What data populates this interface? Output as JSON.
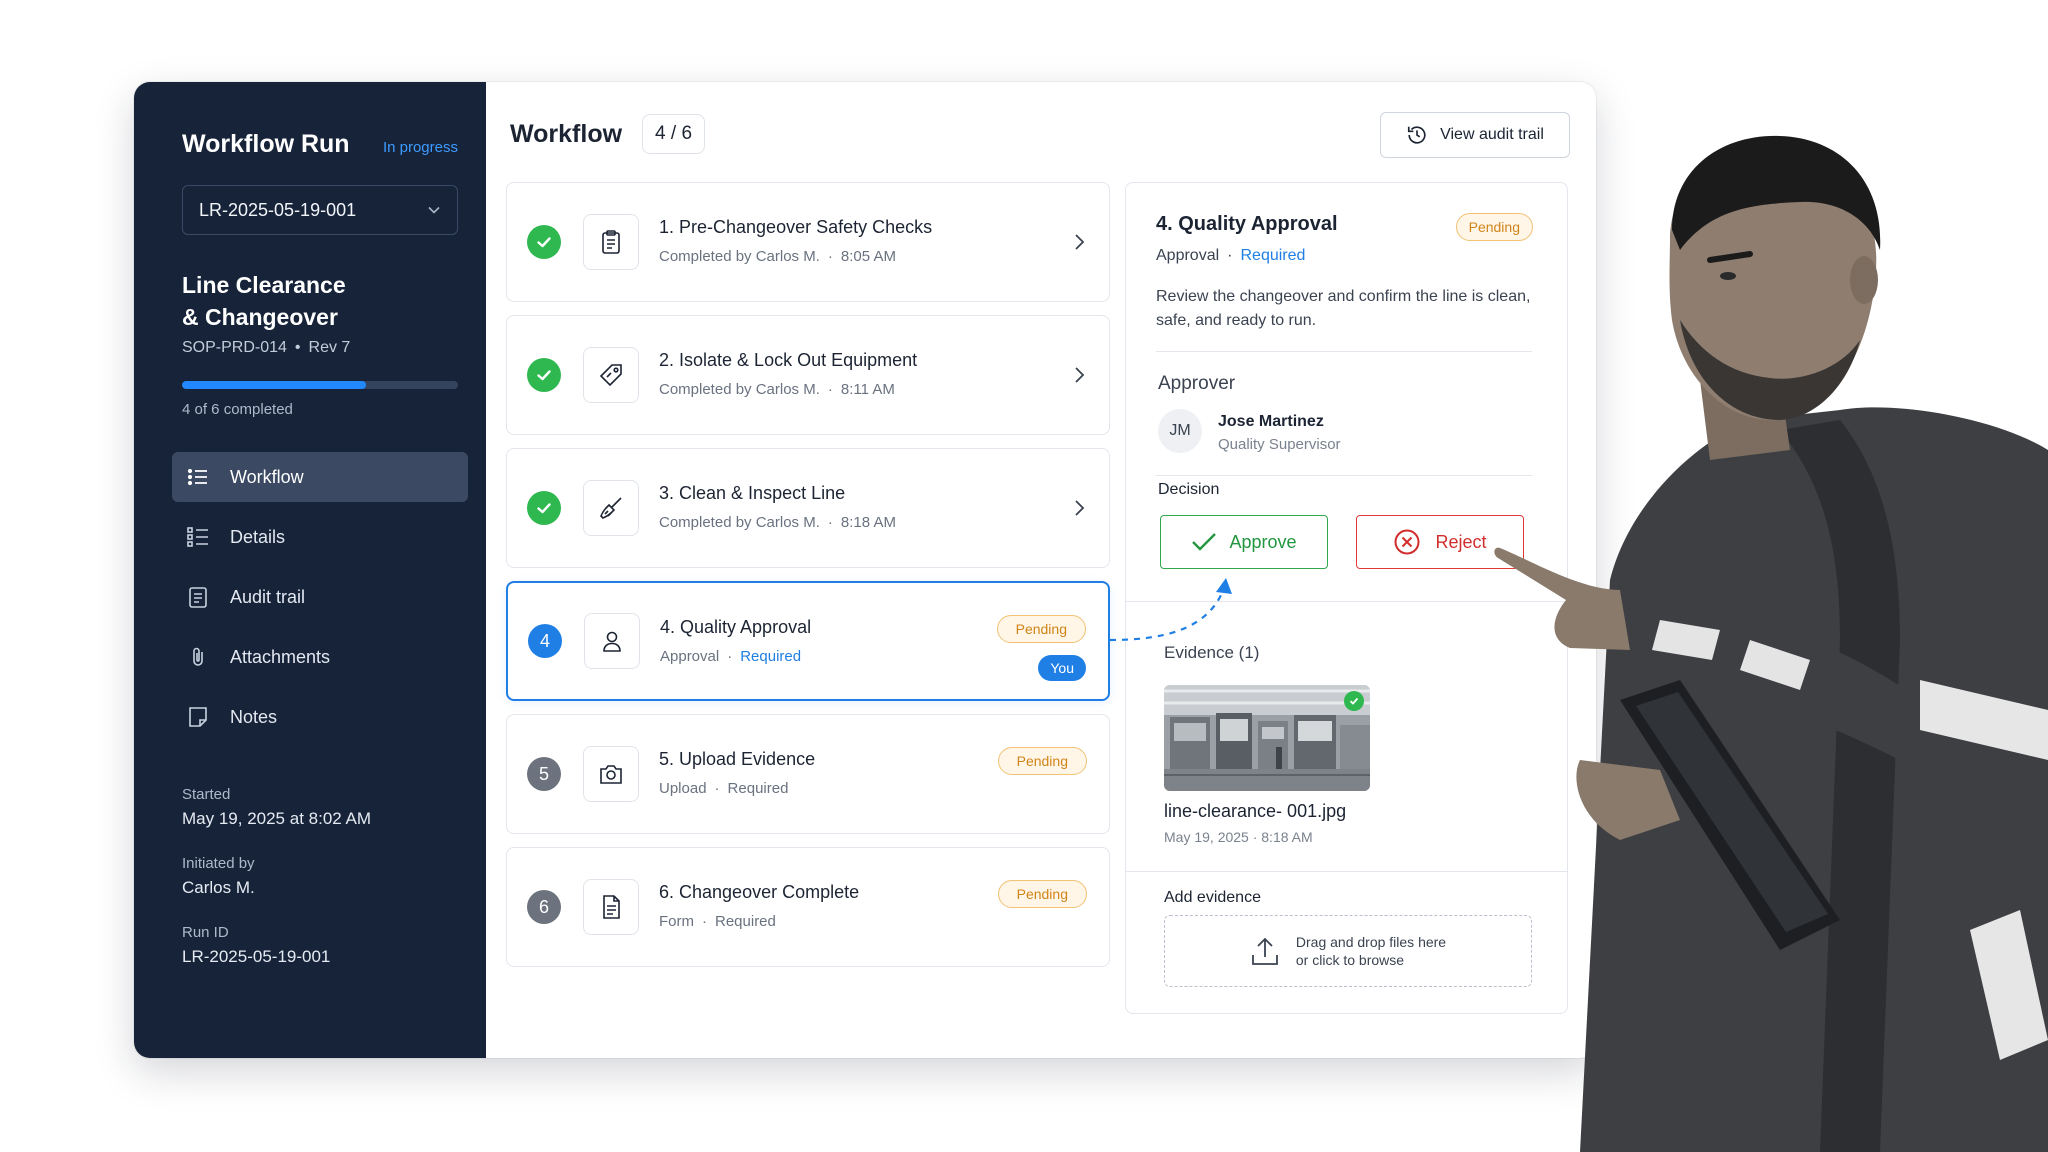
{
  "sidebar": {
    "title": "Workflow Run",
    "status": "In progress",
    "run_select": "LR-2025-05-19-001",
    "procedure_title_line1": "Line Clearance",
    "procedure_title_line2": "& Changeover",
    "sop": "SOP-PRD-014",
    "rev": "Rev 7",
    "progress_fraction": 0.667,
    "progress_text": "4 of 6 completed",
    "nav": [
      {
        "label": "Workflow",
        "icon": "list-icon",
        "active": true
      },
      {
        "label": "Details",
        "icon": "details-list-icon",
        "active": false
      },
      {
        "label": "Audit trail",
        "icon": "clipboard-icon",
        "active": false
      },
      {
        "label": "Attachments",
        "icon": "paperclip-icon",
        "active": false
      },
      {
        "label": "Notes",
        "icon": "note-icon",
        "active": false
      }
    ],
    "meta": {
      "started_label": "Started",
      "started_value": "May 19, 2025 at 8:02 AM",
      "initiated_label": "Initiated by",
      "initiated_value": "Carlos M.",
      "run_id_label": "Run ID",
      "run_id_value": "LR-2025-05-19-001"
    }
  },
  "main": {
    "title": "Workflow",
    "step_count": "4 / 6",
    "audit_button": "View audit trail",
    "steps": [
      {
        "number": "1",
        "title": "1. Pre-Changeover Safety Checks",
        "sub": "Completed by Carlos M.",
        "time": "8:05 AM",
        "state": "done",
        "icon": "clipboard-icon"
      },
      {
        "number": "2",
        "title": "2. Isolate & Lock Out Equipment",
        "sub": "Completed by Carlos M.",
        "time": "8:11 AM",
        "state": "done",
        "icon": "tag-icon"
      },
      {
        "number": "3",
        "title": "3. Clean & Inspect Line",
        "sub": "Completed by Carlos M.",
        "time": "8:18 AM",
        "state": "done",
        "icon": "broom-icon"
      },
      {
        "number": "4",
        "title": "4.  Quality Approval",
        "type": "Approval",
        "required": "Required",
        "state": "active",
        "badge": "Pending",
        "you": "You",
        "icon": "user-icon"
      },
      {
        "number": "5",
        "title": "5.  Upload Evidence",
        "type": "Upload",
        "required": "Required",
        "state": "pending",
        "badge": "Pending",
        "icon": "camera-icon"
      },
      {
        "number": "6",
        "title": "6.  Changeover Complete",
        "type": "Form",
        "required": "Required",
        "state": "pending",
        "badge": "Pending",
        "icon": "document-icon"
      }
    ]
  },
  "detail": {
    "title": "4.  Quality Approval",
    "badge": "Pending",
    "type": "Approval",
    "required": "Required",
    "description": "Review the changeover and confirm the line is clean, safe, and ready to run.",
    "approver_label": "Approver",
    "approver_initials": "JM",
    "approver_name": "Jose Martinez",
    "approver_role": "Quality Supervisor",
    "decision_label": "Decision",
    "approve_label": "Approve",
    "reject_label": "Reject",
    "evidence_label": "Evidence (1)",
    "evidence_file": "line-clearance- 001.jpg",
    "evidence_date": "May 19, 2025 · 8:18 AM",
    "add_evidence_label": "Add evidence",
    "dropzone_line1": "Drag and drop files here",
    "dropzone_line2": "or click to browse"
  },
  "colors": {
    "sidebar_bg": "#162338",
    "accent_blue": "#1f7fe5",
    "success_green": "#2fb84f",
    "pending_orange": "#d18417",
    "reject_red": "#de3a3a"
  }
}
